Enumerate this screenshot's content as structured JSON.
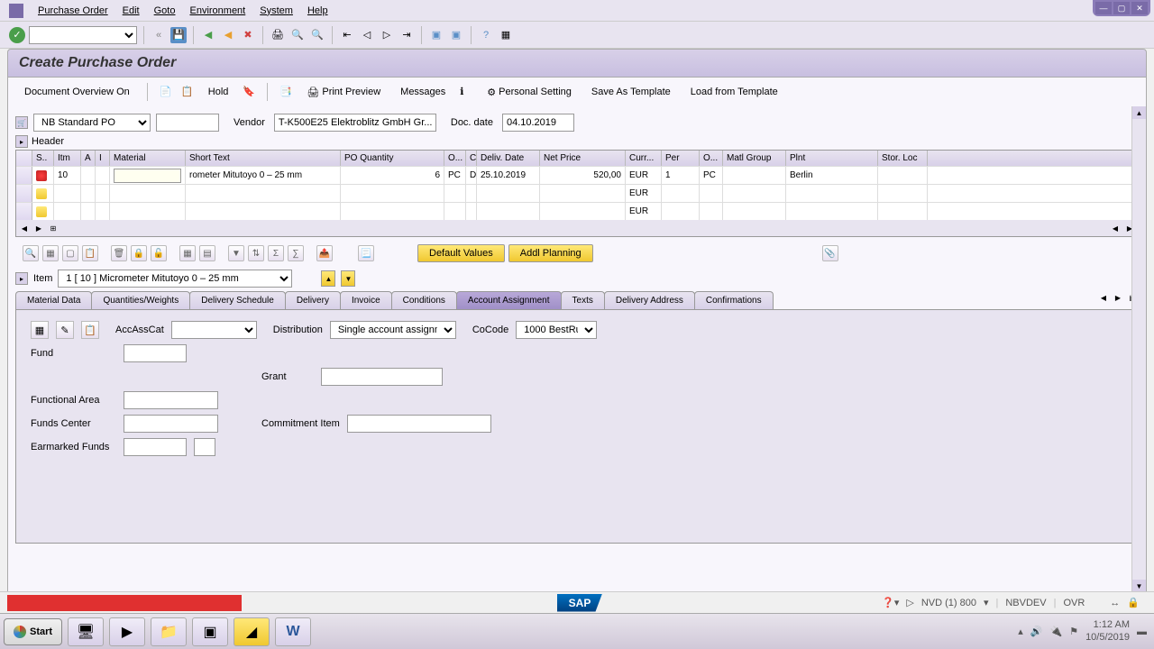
{
  "menu": {
    "items": [
      "Purchase Order",
      "Edit",
      "Goto",
      "Environment",
      "System",
      "Help"
    ]
  },
  "title": "Create Purchase Order",
  "app_toolbar": {
    "doc_overview": "Document Overview On",
    "hold": "Hold",
    "print_preview": "Print Preview",
    "messages": "Messages",
    "personal_setting": "Personal Setting",
    "save_template": "Save As Template",
    "load_template": "Load from Template"
  },
  "doc": {
    "type": "NB Standard PO",
    "vendor_label": "Vendor",
    "vendor_value": "T-K500E25 Elektroblitz GmbH Gr...",
    "docdate_label": "Doc. date",
    "docdate_value": "04.10.2019"
  },
  "header_label": "Header",
  "grid": {
    "columns": [
      "S..",
      "Itm",
      "A",
      "I",
      "Material",
      "Short Text",
      "PO Quantity",
      "O...",
      "C",
      "Deliv. Date",
      "Net Price",
      "Curr...",
      "Per",
      "O...",
      "Matl Group",
      "Plnt",
      "Stor. Loc"
    ],
    "rows": [
      {
        "itm": "10",
        "material": "",
        "short_text": "rometer Mitutoyo 0 – 25 mm",
        "qty": "6",
        "unit": "PC",
        "c": "D",
        "deliv": "25.10.2019",
        "price": "520,00",
        "curr": "EUR",
        "per": "1",
        "ounit": "PC",
        "matlgrp": "",
        "plnt": "Berlin"
      },
      {
        "curr": "EUR"
      },
      {
        "curr": "EUR"
      }
    ]
  },
  "grid_buttons": {
    "default_values": "Default Values",
    "addl_planning": "Addl Planning"
  },
  "item": {
    "label": "Item",
    "value": "1 [ 10 ] Micrometer Mitutoyo 0 – 25 mm"
  },
  "tabs": [
    "Material Data",
    "Quantities/Weights",
    "Delivery Schedule",
    "Delivery",
    "Invoice",
    "Conditions",
    "Account Assignment",
    "Texts",
    "Delivery Address",
    "Confirmations"
  ],
  "active_tab": 6,
  "account_assignment": {
    "acc_ass_cat": "AccAssCat",
    "distribution_label": "Distribution",
    "distribution_value": "Single account assignm..",
    "cocode_label": "CoCode",
    "cocode_value": "1000 BestRu..",
    "fund": "Fund",
    "grant": "Grant",
    "functional_area": "Functional Area",
    "funds_center": "Funds Center",
    "commitment_item": "Commitment Item",
    "earmarked_funds": "Earmarked Funds"
  },
  "status": {
    "sap": "SAP",
    "client": "NVD (1) 800",
    "system": "NBVDEV",
    "mode": "OVR"
  },
  "taskbar": {
    "start": "Start",
    "time": "1:12 AM",
    "date": "10/5/2019"
  }
}
